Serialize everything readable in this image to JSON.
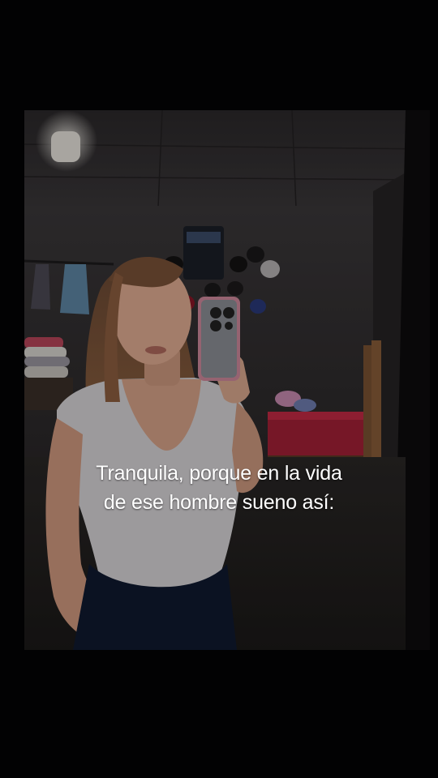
{
  "caption": {
    "line1": "Tranquila, porque en la vida",
    "line2": "de ese hombre sueno así:"
  }
}
